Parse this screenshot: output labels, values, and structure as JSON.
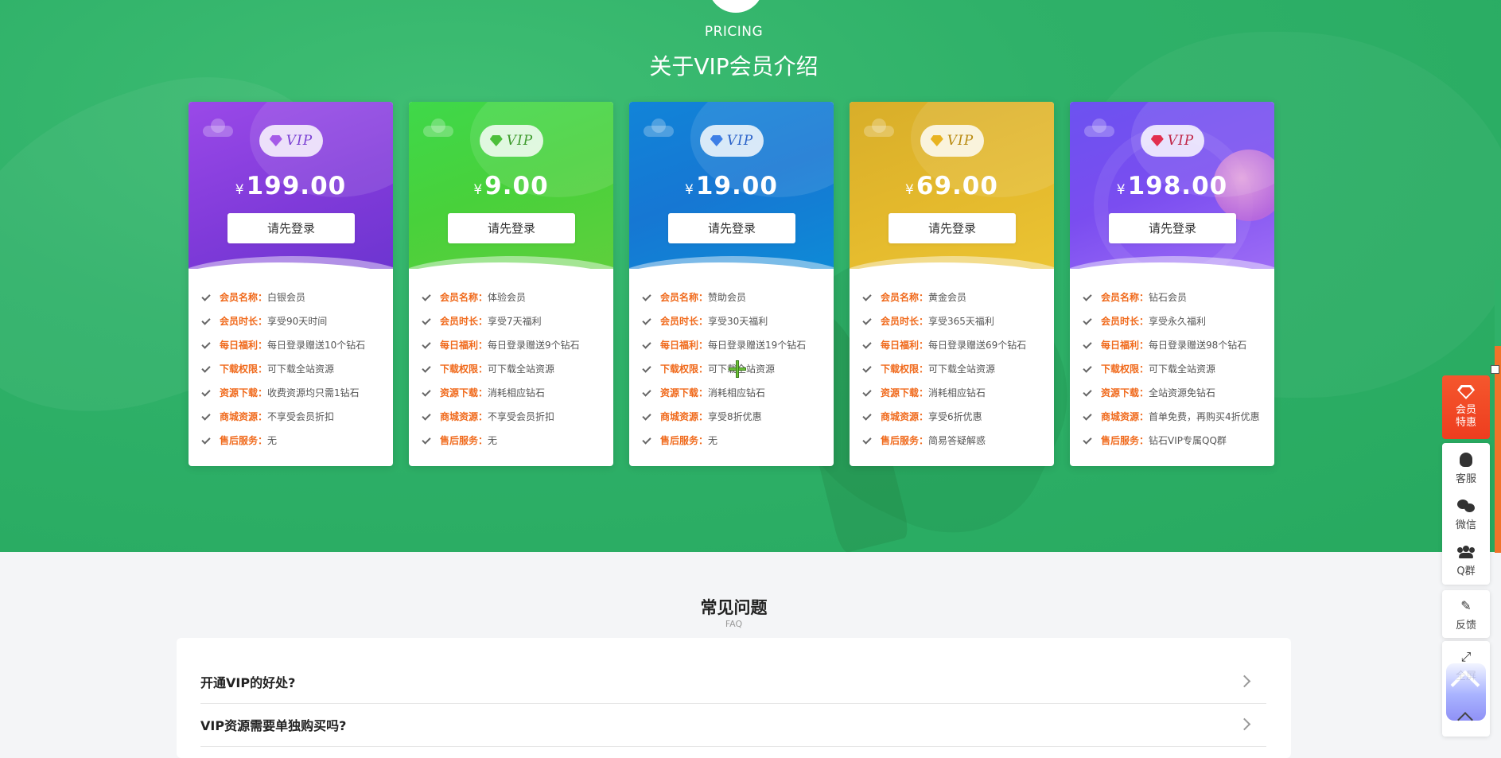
{
  "header": {
    "pricing_label": "PRICING",
    "title": "关于VIP会员介绍"
  },
  "vip_cards": [
    {
      "badge": "VIP",
      "diamond_color": "#a55ae8",
      "currency": "¥",
      "price": "199.00",
      "button": "请先登录",
      "features": [
        {
          "label": "会员名称：",
          "value": "白银会员"
        },
        {
          "label": "会员时长：",
          "value": "享受90天时间"
        },
        {
          "label": "每日福利：",
          "value": "每日登录赠送10个钻石"
        },
        {
          "label": "下载权限：",
          "value": "可下载全站资源"
        },
        {
          "label": "资源下载：",
          "value": "收费资源均只需1钻石"
        },
        {
          "label": "商城资源：",
          "value": "不享受会员折扣"
        },
        {
          "label": "售后服务：",
          "value": "无"
        }
      ]
    },
    {
      "badge": "VIP",
      "diamond_color": "#4bbf3a",
      "currency": "¥",
      "price": "9.00",
      "button": "请先登录",
      "features": [
        {
          "label": "会员名称：",
          "value": "体验会员"
        },
        {
          "label": "会员时长：",
          "value": "享受7天福利"
        },
        {
          "label": "每日福利：",
          "value": "每日登录赠送9个钻石"
        },
        {
          "label": "下载权限：",
          "value": "可下载全站资源"
        },
        {
          "label": "资源下载：",
          "value": "消耗相应钻石"
        },
        {
          "label": "商城资源：",
          "value": "不享受会员折扣"
        },
        {
          "label": "售后服务：",
          "value": "无"
        }
      ]
    },
    {
      "badge": "VIP",
      "diamond_color": "#3d7fe6",
      "currency": "¥",
      "price": "19.00",
      "button": "请先登录",
      "features": [
        {
          "label": "会员名称：",
          "value": "赞助会员"
        },
        {
          "label": "会员时长：",
          "value": "享受30天福利"
        },
        {
          "label": "每日福利：",
          "value": "每日登录赠送19个钻石"
        },
        {
          "label": "下载权限：",
          "value": "可下载全站资源"
        },
        {
          "label": "资源下载：",
          "value": "消耗相应钻石"
        },
        {
          "label": "商城资源：",
          "value": "享受8折优惠"
        },
        {
          "label": "售后服务：",
          "value": "无"
        }
      ]
    },
    {
      "badge": "VIP",
      "diamond_color": "#e8b320",
      "currency": "¥",
      "price": "69.00",
      "button": "请先登录",
      "features": [
        {
          "label": "会员名称：",
          "value": "黄金会员"
        },
        {
          "label": "会员时长：",
          "value": "享受365天福利"
        },
        {
          "label": "每日福利：",
          "value": "每日登录赠送69个钻石"
        },
        {
          "label": "下载权限：",
          "value": "可下载全站资源"
        },
        {
          "label": "资源下载：",
          "value": "消耗相应钻石"
        },
        {
          "label": "商城资源：",
          "value": "享受6折优惠"
        },
        {
          "label": "售后服务：",
          "value": "简易答疑解惑"
        }
      ]
    },
    {
      "badge": "VIP",
      "diamond_color": "#e22e4e",
      "currency": "¥",
      "price": "198.00",
      "button": "请先登录",
      "features": [
        {
          "label": "会员名称：",
          "value": "钻石会员"
        },
        {
          "label": "会员时长：",
          "value": "享受永久福利"
        },
        {
          "label": "每日福利：",
          "value": "每日登录赠送98个钻石"
        },
        {
          "label": "下载权限：",
          "value": "可下载全站资源"
        },
        {
          "label": "资源下载：",
          "value": "全站资源免钻石"
        },
        {
          "label": "商城资源：",
          "value": "首单免费，再购买4折优惠"
        },
        {
          "label": "售后服务：",
          "value": "钻石VIP专属QQ群"
        }
      ]
    }
  ],
  "faq": {
    "title": "常见问题",
    "subtitle": "FAQ",
    "items": [
      "开通VIP的好处?",
      "VIP资源需要单独购买吗?"
    ]
  },
  "sidebar": {
    "vip_label": "会员特惠",
    "service": "客服",
    "wechat": "微信",
    "qq_group": "Q群",
    "feedback": "反馈",
    "fullscreen": "全屏"
  },
  "colors": {
    "hero_green": "#2fb169",
    "feature_label": "#f06a1c",
    "side_vip": "#ee3d1f"
  }
}
